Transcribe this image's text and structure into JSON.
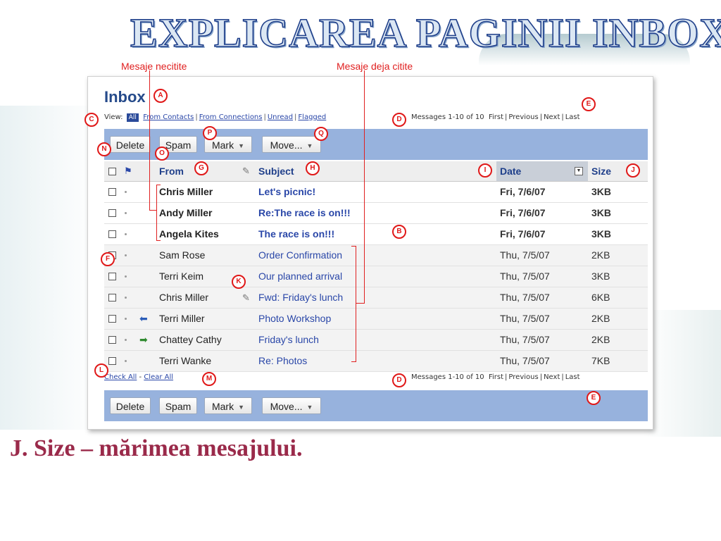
{
  "slide": {
    "title": "EXPLICAREA PAGINII INBOX",
    "caption_unread": "Mesaje necitite",
    "caption_read": "Mesaje deja citite",
    "footer_caption": "J. Size – mărimea mesajului."
  },
  "inbox": {
    "title": "Inbox",
    "view_label": "View:",
    "view_all": "All",
    "filters": [
      "From Contacts",
      "From Connections",
      "Unread",
      "Flagged"
    ],
    "pager_count": "Messages 1-10 of 10",
    "pager_links": [
      "First",
      "Previous",
      "Next",
      "Last"
    ],
    "toolbar": {
      "delete": "Delete",
      "spam": "Spam",
      "mark": "Mark",
      "move": "Move..."
    },
    "columns": {
      "from": "From",
      "subject": "Subject",
      "date": "Date",
      "size": "Size"
    },
    "messages": [
      {
        "from": "Chris Miller",
        "subject": "Let's picnic!",
        "date": "Fri, 7/6/07",
        "size": "3KB",
        "unread": true,
        "icon": ""
      },
      {
        "from": "Andy Miller",
        "subject": "Re:The race is on!!!",
        "date": "Fri, 7/6/07",
        "size": "3KB",
        "unread": true,
        "icon": ""
      },
      {
        "from": "Angela Kites",
        "subject": "The race is on!!!",
        "date": "Fri, 7/6/07",
        "size": "3KB",
        "unread": true,
        "icon": ""
      },
      {
        "from": "Sam Rose",
        "subject": "Order Confirmation",
        "date": "Thu, 7/5/07",
        "size": "2KB",
        "unread": false,
        "icon": ""
      },
      {
        "from": "Terri Keim",
        "subject": "Our planned arrival",
        "date": "Thu, 7/5/07",
        "size": "3KB",
        "unread": false,
        "icon": ""
      },
      {
        "from": "Chris Miller",
        "subject": "Fwd: Friday's lunch",
        "date": "Thu, 7/5/07",
        "size": "6KB",
        "unread": false,
        "icon": "attachment-icon"
      },
      {
        "from": "Terri Miller",
        "subject": "Photo Workshop",
        "date": "Thu, 7/5/07",
        "size": "2KB",
        "unread": false,
        "icon": "reply-icon"
      },
      {
        "from": "Chattey Cathy",
        "subject": "Friday's lunch",
        "date": "Thu, 7/5/07",
        "size": "2KB",
        "unread": false,
        "icon": "forward-icon"
      },
      {
        "from": "Terri Wanke",
        "subject": "Re: Photos",
        "date": "Thu, 7/5/07",
        "size": "7KB",
        "unread": false,
        "icon": ""
      }
    ],
    "check_all": "Check All",
    "clear_all": "Clear All"
  },
  "markers": [
    "A",
    "B",
    "C",
    "D",
    "E",
    "F",
    "G",
    "H",
    "I",
    "J",
    "K",
    "L",
    "M",
    "N",
    "O",
    "P",
    "Q"
  ],
  "colors": {
    "toolbar_bg": "#97b2dd",
    "marker_red": "#e01818",
    "link_blue": "#2a47a8",
    "title_blue": "#254a8a"
  }
}
